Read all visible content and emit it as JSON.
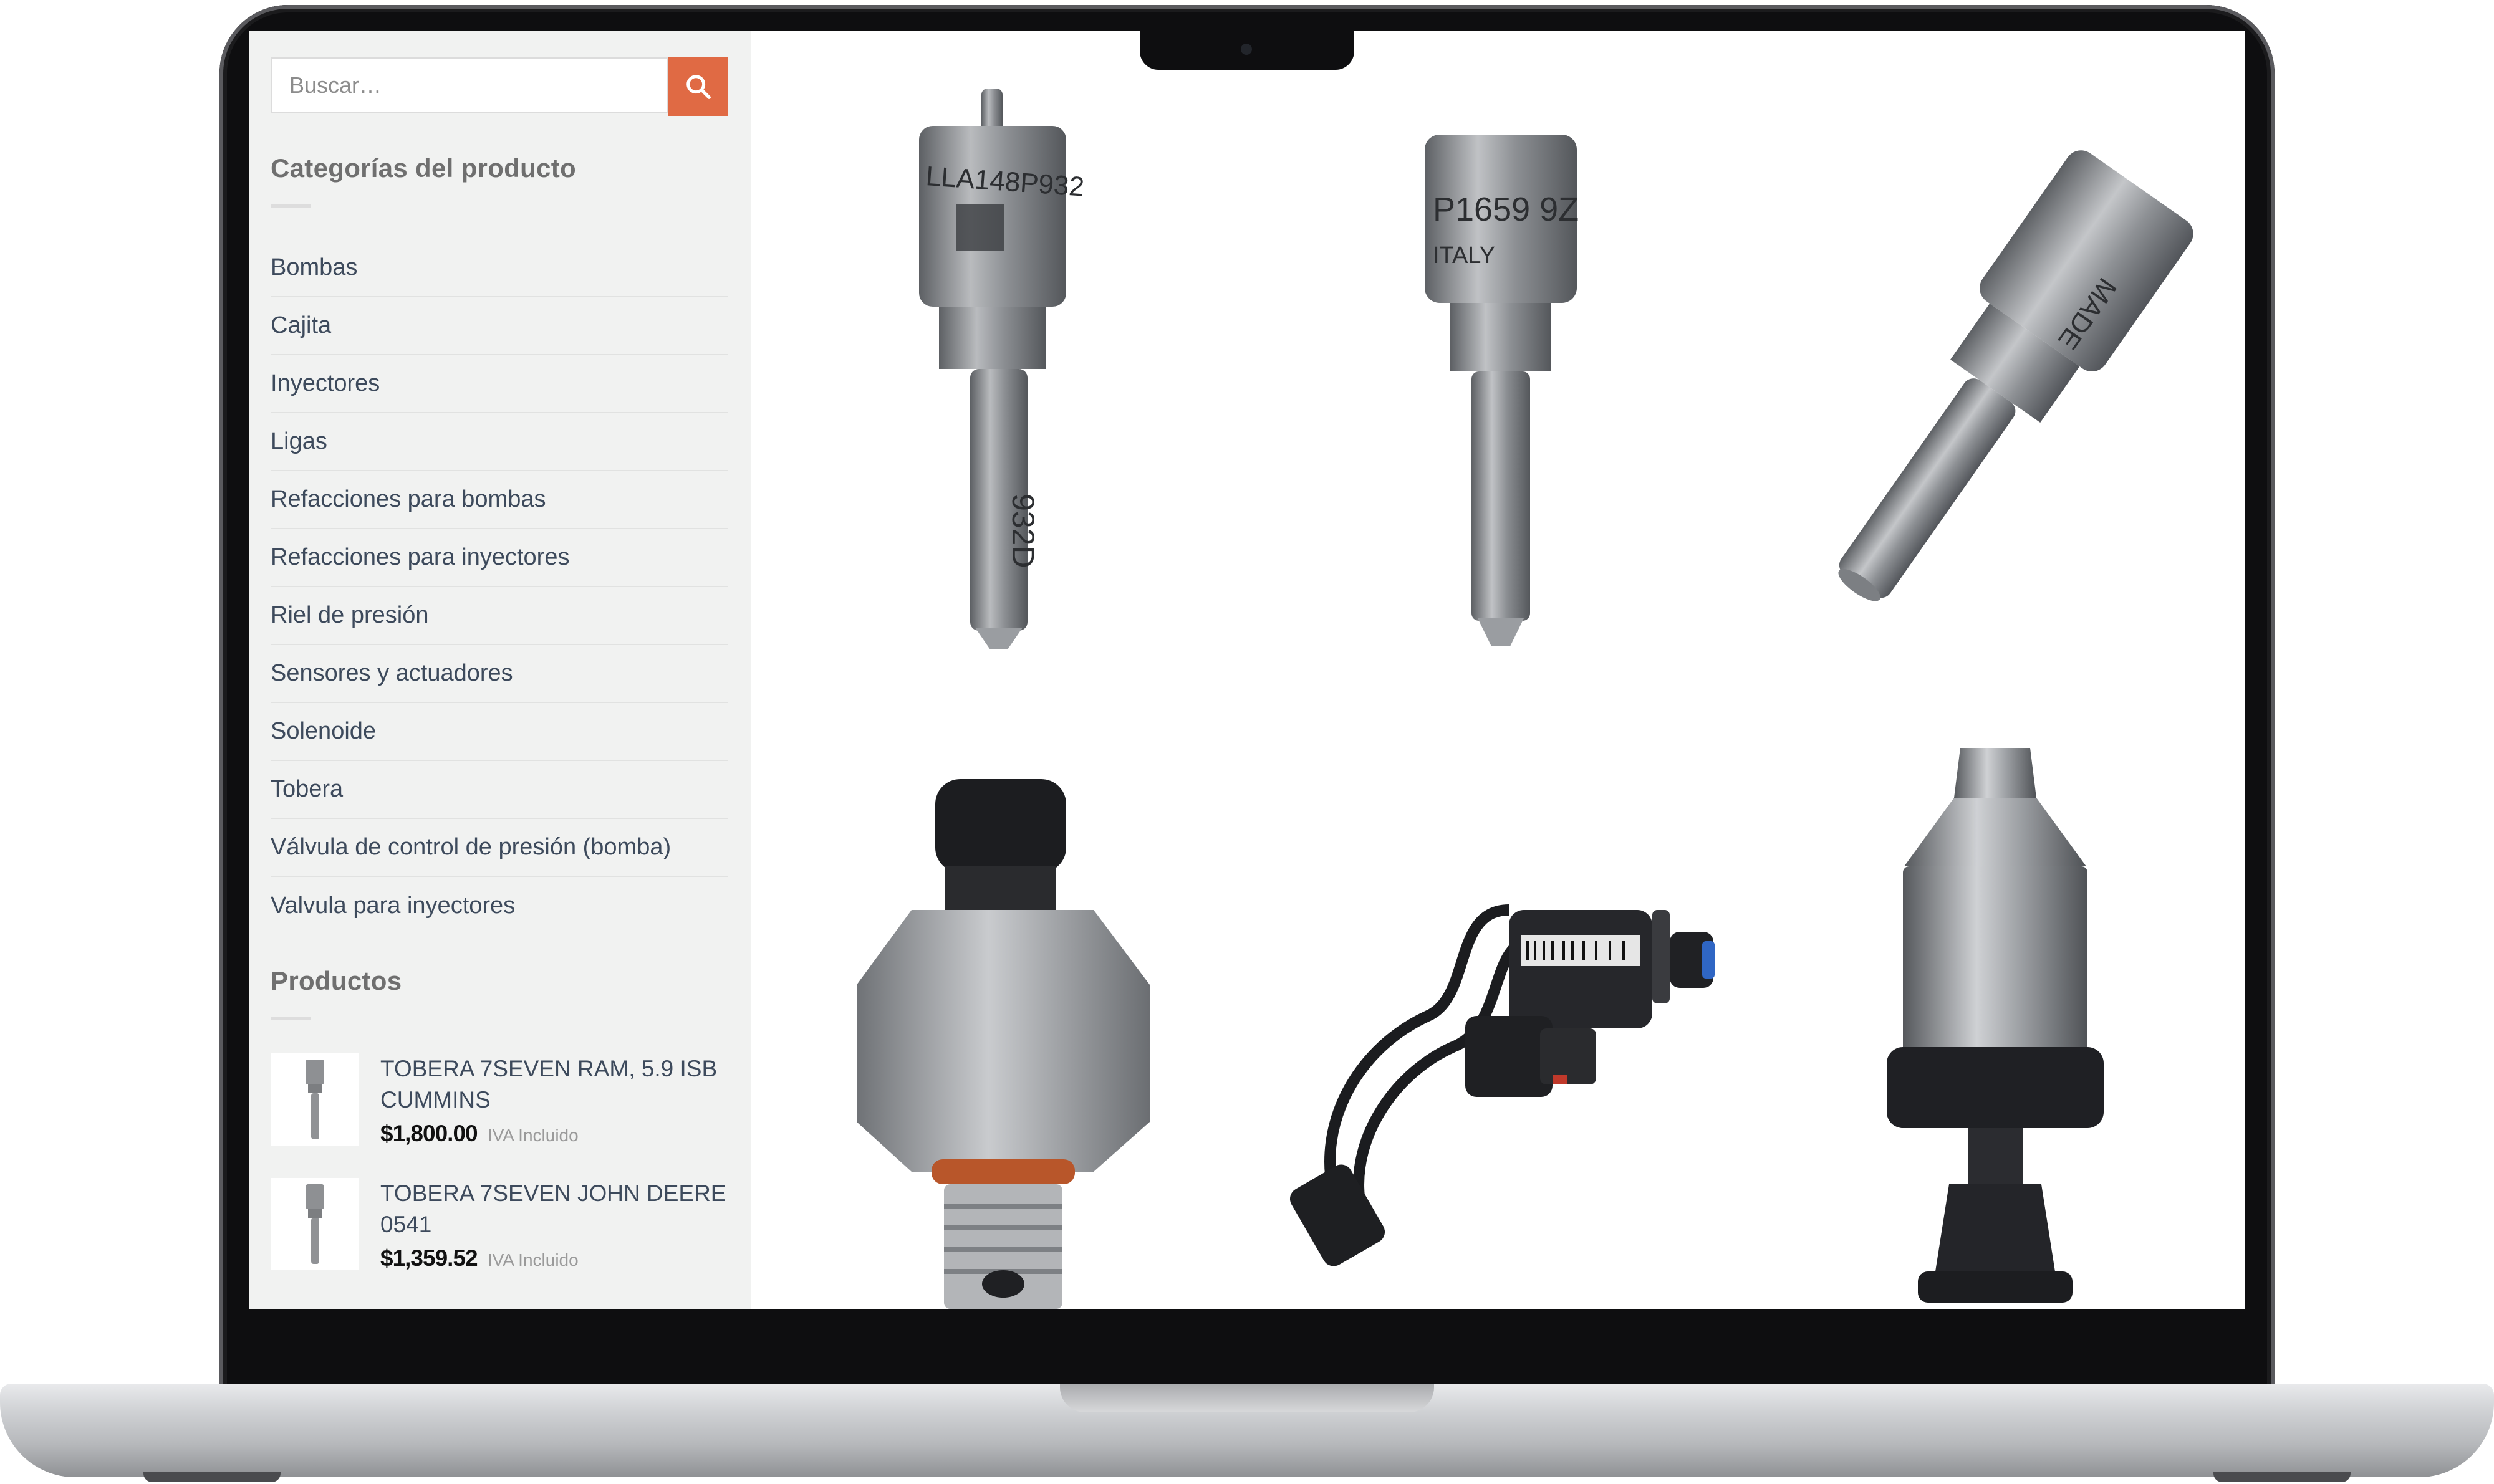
{
  "search": {
    "placeholder": "Buscar…"
  },
  "categories": {
    "title": "Categorías del producto",
    "items": [
      {
        "label": "Bombas"
      },
      {
        "label": "Cajita"
      },
      {
        "label": "Inyectores"
      },
      {
        "label": "Ligas"
      },
      {
        "label": "Refacciones para bombas"
      },
      {
        "label": "Refacciones para inyectores"
      },
      {
        "label": "Riel de presión"
      },
      {
        "label": "Sensores y actuadores"
      },
      {
        "label": "Solenoide"
      },
      {
        "label": "Tobera"
      },
      {
        "label": "Válvula de control de presión (bomba)"
      },
      {
        "label": "Valvula para inyectores"
      }
    ]
  },
  "products": {
    "title": "Productos",
    "items": [
      {
        "name": "TOBERA 7SEVEN RAM, 5.9 ISB CUMMINS",
        "price": "$1,800.00",
        "tax_note": "IVA Incluido"
      },
      {
        "name": "TOBERA 7SEVEN JOHN DEERE 0541",
        "price": "$1,359.52",
        "tax_note": "IVA Incluido"
      }
    ]
  },
  "grid": {
    "tiles": [
      {
        "image": "injector-nozzle",
        "engraving": [
          "LLA148P932",
          "932D"
        ]
      },
      {
        "image": "injector-nozzle",
        "engraving": [
          "P1659 9Z",
          "ITALY"
        ]
      },
      {
        "image": "injector-nozzle-angled",
        "engraving": [
          "MADE"
        ]
      },
      {
        "image": "pressure-sensor"
      },
      {
        "image": "solenoid-valve-with-harness"
      },
      {
        "image": "injector-valve-assembly"
      }
    ]
  },
  "colors": {
    "accent": "#e06a44",
    "sidebar_bg": "#f1f2f1",
    "link": "#3d4a5c",
    "heading": "#6f6f6f"
  }
}
